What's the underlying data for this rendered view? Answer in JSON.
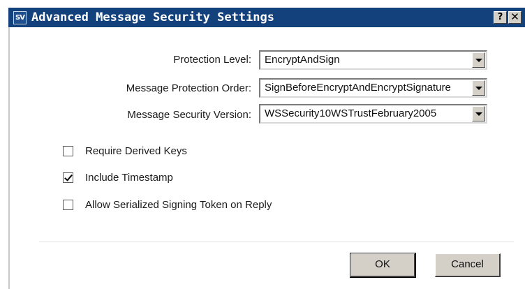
{
  "titlebar": {
    "icon_text": "SV",
    "title": "Advanced Message Security Settings",
    "help_label": "?",
    "close_label": "✕"
  },
  "fields": {
    "protection_level": {
      "label": "Protection Level:",
      "value": "EncryptAndSign"
    },
    "protection_order": {
      "label": "Message Protection Order:",
      "value": "SignBeforeEncryptAndEncryptSignature"
    },
    "security_version": {
      "label": "Message Security Version:",
      "value": "WSSecurity10WSTrustFebruary2005"
    }
  },
  "options": [
    {
      "label": "Require Derived Keys",
      "checked": false
    },
    {
      "label": "Include Timestamp",
      "checked": true
    },
    {
      "label": "Allow Serialized Signing Token on Reply",
      "checked": false
    }
  ],
  "buttons": {
    "ok": "OK",
    "cancel": "Cancel"
  },
  "colors": {
    "titlebar": "#13417c",
    "button_face": "#d4d0c8"
  },
  "icons": {
    "app": "sv-app-icon",
    "help": "question-icon",
    "close": "close-icon",
    "dropdown": "chevron-down-icon",
    "check": "checkmark-icon"
  }
}
